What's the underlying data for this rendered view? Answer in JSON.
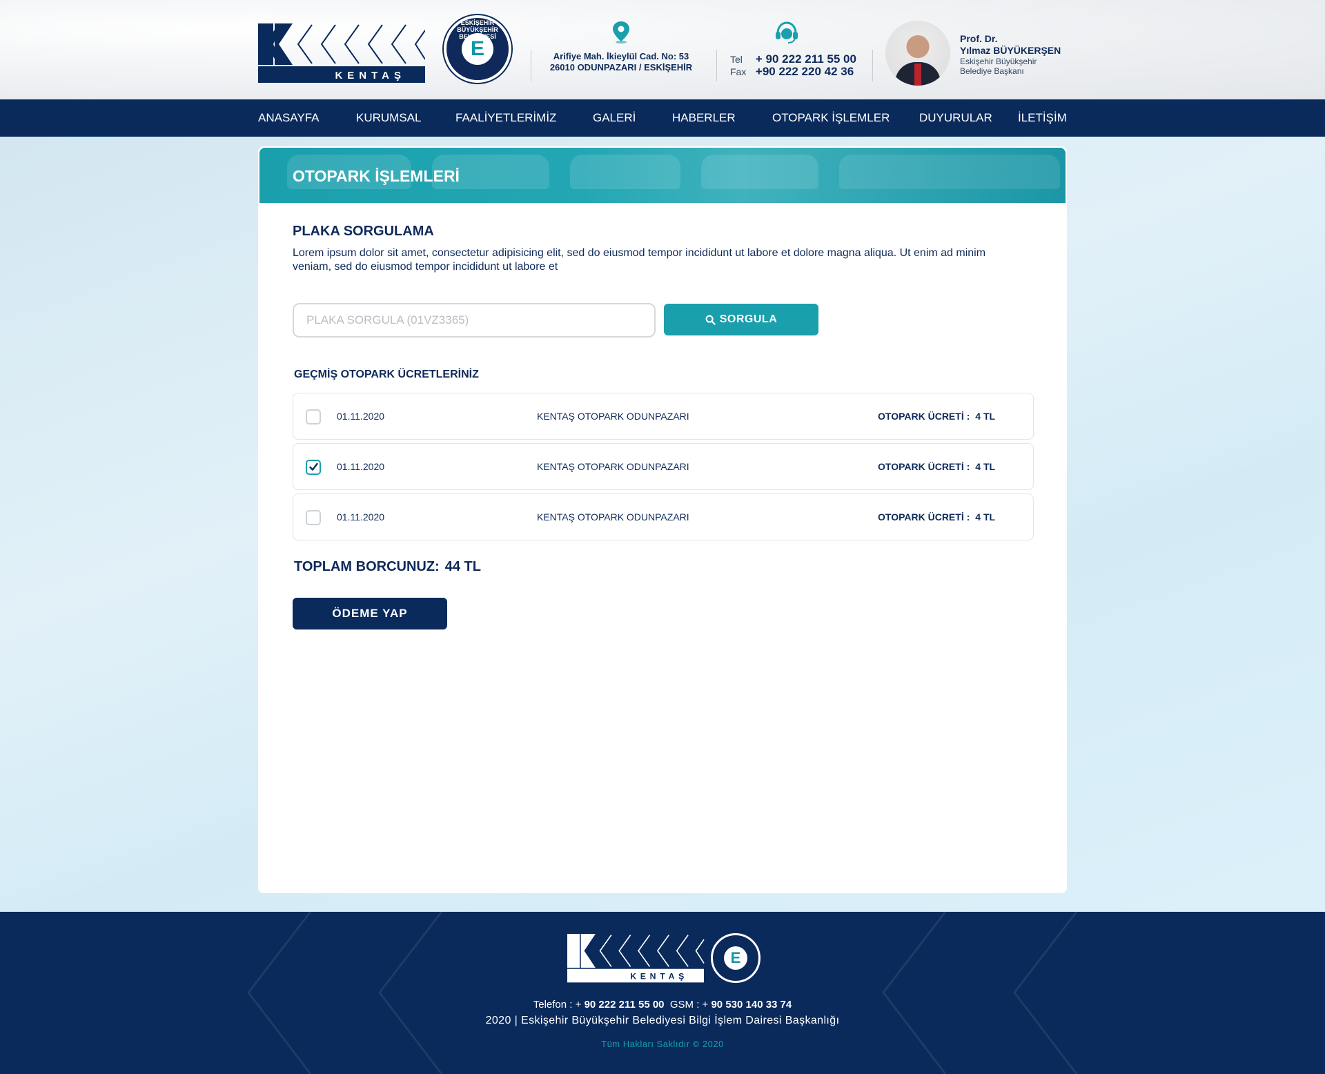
{
  "header": {
    "logo_text": "KENTAŞ",
    "emblem_text": "ESKİŞEHİR BÜYÜKŞEHİR BELEDİYESİ",
    "address_line1": "Arifiye Mah. İkieylül Cad. No: 53",
    "address_line2": "26010 ODUNPAZARI / ESKİŞEHİR",
    "tel_label": "Tel",
    "tel_value": "+ 90 222 211 55 00",
    "fax_label": "Fax",
    "fax_value": "+90 222 220 42 36",
    "mayor_title": "Prof. Dr.",
    "mayor_name": "Yılmaz BÜYÜKERŞEN",
    "mayor_role_line1": "Eskişehir Büyükşehir",
    "mayor_role_line2": "Belediye Başkanı"
  },
  "nav": {
    "items": [
      {
        "label": "ANASAYFA"
      },
      {
        "label": "KURUMSAL"
      },
      {
        "label": "FAALİYETLERİMİZ"
      },
      {
        "label": "GALERİ"
      },
      {
        "label": "HABERLER"
      },
      {
        "label": "OTOPARK İŞLEMLER"
      },
      {
        "label": "DUYURULAR"
      },
      {
        "label": "İLETİŞİM"
      }
    ]
  },
  "main": {
    "banner_title": "OTOPARK İŞLEMLERİ",
    "section_title": "PLAKA SORGULAMA",
    "description": "Lorem ipsum dolor sit amet, consectetur adipisicing elit, sed do eiusmod tempor incididunt ut labore et dolore magna aliqua. Ut enim ad minim veniam, sed do eiusmod tempor incididunt ut labore et",
    "search": {
      "placeholder": "PLAKA SORGULA (01VZ3365)",
      "value": "",
      "button_label": "SORGULA",
      "button_icon": "search-icon"
    },
    "past_title": "GEÇMİŞ OTOPARK ÜCRETLERİNİZ",
    "records": [
      {
        "checked": false,
        "date": "01.11.2020",
        "location": "KENTAŞ OTOPARK ODUNPAZARI",
        "fee_label": "OTOPARK ÜCRETİ :",
        "fee_value": "4 TL"
      },
      {
        "checked": true,
        "date": "01.11.2020",
        "location": "KENTAŞ OTOPARK ODUNPAZARI",
        "fee_label": "OTOPARK ÜCRETİ :",
        "fee_value": "4 TL"
      },
      {
        "checked": false,
        "date": "01.11.2020",
        "location": "KENTAŞ OTOPARK ODUNPAZARI",
        "fee_label": "OTOPARK ÜCRETİ :",
        "fee_value": "4 TL"
      }
    ],
    "total_label": "TOPLAM BORCUNUZ:",
    "total_value": "44 TL",
    "pay_button_label": "ÖDEME YAP"
  },
  "footer": {
    "phone_label": "Telefon : +",
    "phone_value": "90 222 211 55 00",
    "gsm_label": "GSM : +",
    "gsm_value": "90 530 140 33 74",
    "org_line": "2020 | Eskişehir Büyükşehir Belediyesi Bilgi İşlem Dairesi Başkanlığı",
    "copyright": "Tüm Hakları Saklıdır © 2020"
  },
  "colors": {
    "navy": "#0a2a5c",
    "teal": "#1a9fad",
    "background": "#d9edf6"
  }
}
